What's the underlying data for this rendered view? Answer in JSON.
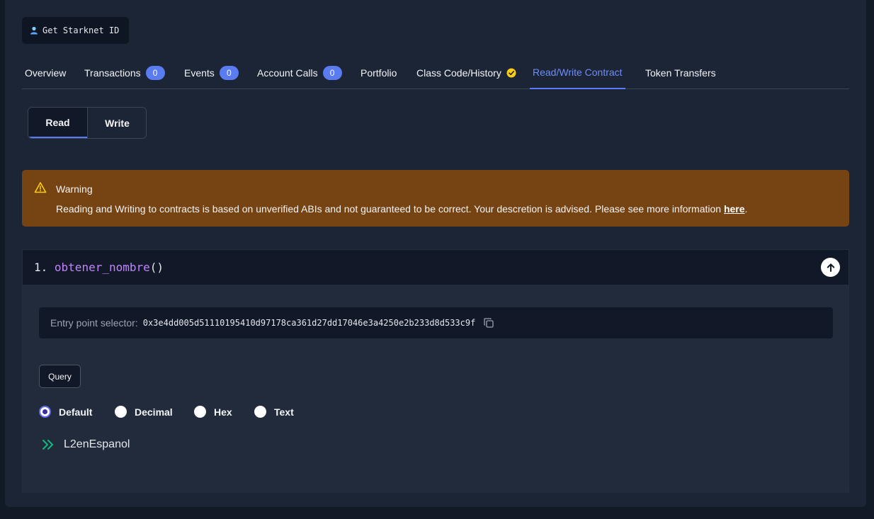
{
  "header": {
    "starknet_id_label": "Get Starknet ID"
  },
  "tabs": [
    {
      "label": "Overview"
    },
    {
      "label": "Transactions",
      "badge": "0"
    },
    {
      "label": "Events",
      "badge": "0"
    },
    {
      "label": "Account Calls",
      "badge": "0"
    },
    {
      "label": "Portfolio"
    },
    {
      "label": "Class Code/History",
      "icon": "verified-icon"
    },
    {
      "label": "Read/Write Contract",
      "active": true
    },
    {
      "label": "Token Transfers"
    }
  ],
  "mode": {
    "read_label": "Read",
    "write_label": "Write",
    "selected": "Read"
  },
  "warning": {
    "title": "Warning",
    "text": "Reading and Writing to contracts is based on unverified ABIs and not guaranteed to be correct. Your descretion is advised. Please see more information ",
    "link_label": "here",
    "text_end": "."
  },
  "function": {
    "index": "1.",
    "name": "obtener_nombre",
    "parens": "()",
    "selector_label": "Entry point selector:",
    "selector_value": "0x3e4dd005d51110195410d97178ca361d27dd17046e3a4250e2b233d8d533c9f",
    "query_label": "Query",
    "formats": [
      "Default",
      "Decimal",
      "Hex",
      "Text"
    ],
    "selected_format": "Default",
    "result": "L2enEspanol"
  },
  "colors": {
    "accent": "#5b7cf7",
    "warning_bg": "#764313",
    "verified": "#facc15",
    "result_arrow": "#10b981",
    "function_name": "#c084fc"
  }
}
